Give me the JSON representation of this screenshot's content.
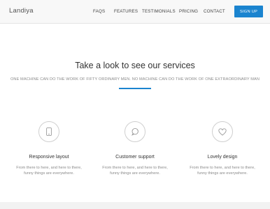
{
  "navbar": {
    "brand": "Landiya",
    "links": [
      "FAQS",
      "FEATURES",
      "TESTIMONIALS",
      "PRICING",
      "CONTACT"
    ],
    "signup_label": "SIGN UP"
  },
  "services": {
    "title": "Take a look to see our services",
    "subtitle": "ONE MACHINE CAN DO THE WORK OF FIFTY ORDINARY MEN. NO MACHINE CAN DO THE WORK OF ONE EXTRAORDINARY MAN",
    "accent_color": "#1a84cf",
    "features": [
      {
        "icon": "mobile-icon",
        "title": "Responsive layout",
        "description": "From there to here, and here to there, funny things are everywhere."
      },
      {
        "icon": "chat-bubble-icon",
        "title": "Customer support",
        "description": "From there to here, and here to there, funny things are everywhere."
      },
      {
        "icon": "heart-icon",
        "title": "Lovely design",
        "description": "From there to here, and here to there, funny things are everywhere."
      }
    ]
  }
}
